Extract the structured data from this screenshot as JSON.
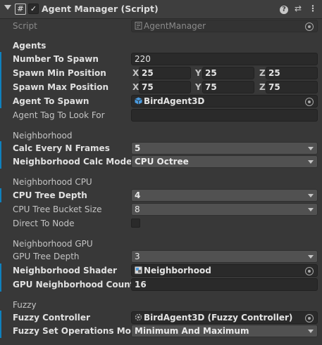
{
  "header": {
    "title": "Agent Manager (Script)",
    "enabled": true
  },
  "script": {
    "label": "Script",
    "value": "AgentManager"
  },
  "sections": {
    "agents": "Agents",
    "neighborhood": "Neighborhood",
    "neighborhood_cpu": "Neighborhood CPU",
    "neighborhood_gpu": "Neighborhood GPU",
    "fuzzy": "Fuzzy"
  },
  "fields": {
    "number_to_spawn": {
      "label": "Number To Spawn",
      "value": "220"
    },
    "spawn_min": {
      "label": "Spawn Min Position",
      "x": "25",
      "y": "25",
      "z": "25"
    },
    "spawn_max": {
      "label": "Spawn Max Position",
      "x": "75",
      "y": "75",
      "z": "75"
    },
    "agent_to_spawn": {
      "label": "Agent To Spawn",
      "value": "BirdAgent3D"
    },
    "agent_tag": {
      "label": "Agent Tag To Look For",
      "value": ""
    },
    "calc_every": {
      "label": "Calc Every N Frames",
      "value": "5"
    },
    "calc_mode": {
      "label": "Neighborhood Calc Mode",
      "value": "CPU Octree"
    },
    "cpu_depth": {
      "label": "CPU Tree Depth",
      "value": "4"
    },
    "cpu_bucket": {
      "label": "CPU Tree Bucket Size",
      "value": "8"
    },
    "direct_node": {
      "label": "Direct To Node",
      "checked": false
    },
    "gpu_depth": {
      "label": "GPU Tree Depth",
      "value": "3"
    },
    "shader": {
      "label": "Neighborhood Shader",
      "value": "Neighborhood"
    },
    "gpu_count": {
      "label": "GPU Neighborhood Count",
      "value": "16"
    },
    "fuzzy_controller": {
      "label": "Fuzzy Controller",
      "value": "BirdAgent3D (Fuzzy Controller)"
    },
    "fuzzy_ops": {
      "label": "Fuzzy Set Operations Mode",
      "value": "Minimum And Maximum"
    }
  },
  "axis_labels": {
    "x": "X",
    "y": "Y",
    "z": "Z"
  },
  "colors": {
    "modified_bar": "#0f81be",
    "background": "#383838"
  }
}
